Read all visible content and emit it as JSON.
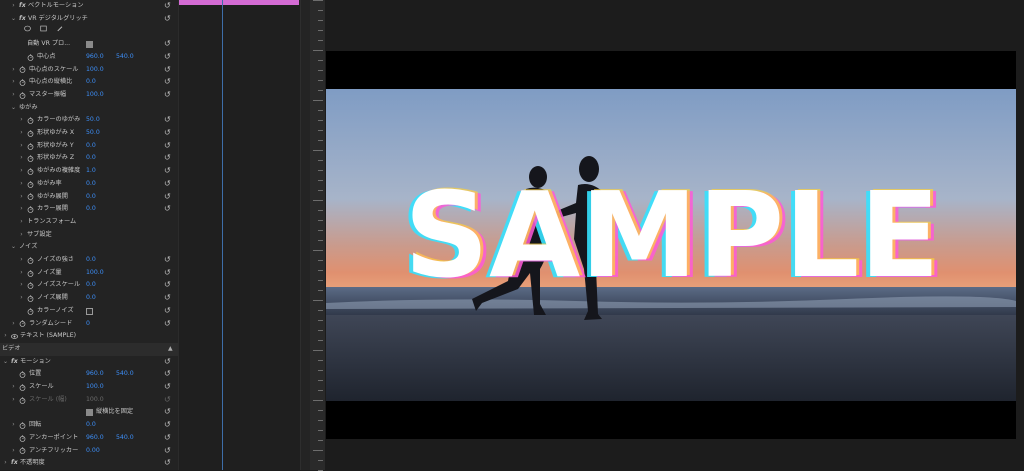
{
  "effect_controls": {
    "rows": [
      {
        "kind": "prop",
        "indent": 1,
        "twirl": "›",
        "fx": true,
        "label": "ベクトルモーション",
        "reset": true
      },
      {
        "kind": "prop",
        "indent": 1,
        "twirl": "⌄",
        "fx": true,
        "label": "VR デジタルグリッチ",
        "reset": true
      },
      {
        "kind": "masktools"
      },
      {
        "kind": "check",
        "indent": 2,
        "label": "自動 VR プロ...",
        "checked": true,
        "reset": true
      },
      {
        "kind": "prop",
        "indent": 2,
        "stopwatch": true,
        "label": "中心点",
        "value1": "960.0",
        "value2": "540.0",
        "reset": true
      },
      {
        "kind": "prop",
        "indent": 1,
        "twirl": "›",
        "stopwatch": true,
        "label": "中心点のスケール",
        "value1": "100.0",
        "reset": true
      },
      {
        "kind": "prop",
        "indent": 1,
        "twirl": "›",
        "stopwatch": true,
        "label": "中心点の縦横比",
        "value1": "0.0",
        "reset": true
      },
      {
        "kind": "prop",
        "indent": 1,
        "twirl": "›",
        "stopwatch": true,
        "label": "マスター振幅",
        "value1": "100.0",
        "reset": true
      },
      {
        "kind": "group",
        "indent": 1,
        "twirl": "⌄",
        "label": "ゆがみ"
      },
      {
        "kind": "prop",
        "indent": 2,
        "twirl": "›",
        "stopwatch": true,
        "label": "カラーのゆがみ",
        "value1": "50.0",
        "reset": true
      },
      {
        "kind": "prop",
        "indent": 2,
        "twirl": "›",
        "stopwatch": true,
        "label": "形状ゆがみ X",
        "value1": "50.0",
        "reset": true
      },
      {
        "kind": "prop",
        "indent": 2,
        "twirl": "›",
        "stopwatch": true,
        "label": "形状ゆがみ Y",
        "value1": "0.0",
        "reset": true
      },
      {
        "kind": "prop",
        "indent": 2,
        "twirl": "›",
        "stopwatch": true,
        "label": "形状ゆがみ Z",
        "value1": "0.0",
        "reset": true
      },
      {
        "kind": "prop",
        "indent": 2,
        "twirl": "›",
        "stopwatch": true,
        "label": "ゆがみの複雑度",
        "value1": "1.0",
        "reset": true
      },
      {
        "kind": "prop",
        "indent": 2,
        "twirl": "›",
        "stopwatch": true,
        "label": "ゆがみ率",
        "value1": "0.0",
        "reset": true
      },
      {
        "kind": "prop",
        "indent": 2,
        "twirl": "›",
        "stopwatch": true,
        "label": "ゆがみ展開",
        "value1": "0.0",
        "reset": true
      },
      {
        "kind": "prop",
        "indent": 2,
        "twirl": "›",
        "stopwatch": true,
        "label": "カラー展開",
        "value1": "0.0",
        "reset": true
      },
      {
        "kind": "group",
        "indent": 2,
        "twirl": "›",
        "label": "トランスフォーム"
      },
      {
        "kind": "group",
        "indent": 2,
        "twirl": "›",
        "label": "サブ設定"
      },
      {
        "kind": "group",
        "indent": 1,
        "twirl": "⌄",
        "label": "ノイズ"
      },
      {
        "kind": "prop",
        "indent": 2,
        "twirl": "›",
        "stopwatch": true,
        "label": "ノイズの強さ",
        "value1": "0.0",
        "reset": true
      },
      {
        "kind": "prop",
        "indent": 2,
        "twirl": "›",
        "stopwatch": true,
        "label": "ノイズ量",
        "value1": "100.0",
        "reset": true
      },
      {
        "kind": "prop",
        "indent": 2,
        "twirl": "›",
        "stopwatch": true,
        "label": "ノイズスケール",
        "value1": "0.0",
        "reset": true
      },
      {
        "kind": "prop",
        "indent": 2,
        "twirl": "›",
        "stopwatch": true,
        "label": "ノイズ展開",
        "value1": "0.0",
        "reset": true
      },
      {
        "kind": "check",
        "indent": 2,
        "stopwatch": true,
        "label": "カラーノイズ",
        "checked": false,
        "reset": true
      },
      {
        "kind": "prop",
        "indent": 1,
        "twirl": "›",
        "stopwatch": true,
        "label": "ランダムシード",
        "value1": "0",
        "reset": true
      },
      {
        "kind": "text",
        "indent": 0,
        "twirl": "›",
        "eye": true,
        "label": "テキスト (SAMPLE)"
      },
      {
        "kind": "section",
        "label": "ビデオ"
      },
      {
        "kind": "prop",
        "indent": 0,
        "twirl": "⌄",
        "fx": true,
        "label": "モーション",
        "reset": true
      },
      {
        "kind": "prop",
        "indent": 1,
        "stopwatch": true,
        "label": "位置",
        "value1": "960.0",
        "value2": "540.0",
        "reset": true
      },
      {
        "kind": "prop",
        "indent": 1,
        "twirl": "›",
        "stopwatch": true,
        "label": "スケール",
        "value1": "100.0",
        "reset": true
      },
      {
        "kind": "prop",
        "indent": 1,
        "twirl": "›",
        "stopwatch": true,
        "label": "スケール (幅)",
        "value1": "100.0",
        "reset": true,
        "dim": true
      },
      {
        "kind": "check",
        "indent": 3,
        "label": "縦横比を固定",
        "checked": true,
        "reset": true
      },
      {
        "kind": "prop",
        "indent": 1,
        "twirl": "›",
        "stopwatch": true,
        "label": "回転",
        "value1": "0.0",
        "reset": true
      },
      {
        "kind": "prop",
        "indent": 1,
        "stopwatch": true,
        "label": "アンカーポイント",
        "value1": "960.0",
        "value2": "540.0",
        "reset": true
      },
      {
        "kind": "prop",
        "indent": 1,
        "twirl": "›",
        "stopwatch": true,
        "label": "アンチフリッカー",
        "value1": "0.00",
        "reset": true
      },
      {
        "kind": "prop",
        "indent": 0,
        "twirl": "›",
        "fx": true,
        "label": "不透明度",
        "reset": true
      }
    ]
  },
  "program_monitor": {
    "overlay_text": "SAMPLE",
    "colors": {
      "sky_top": "#7f9cc4",
      "horizon": "#d79079",
      "sea": "#4a5a72",
      "sand": "#3a4150",
      "glitch_cyan": "#36e2ff",
      "glitch_pink": "#ff5ad8",
      "glitch_yellow": "#ffd23a"
    }
  },
  "timeline": {
    "clip_color": "#d36bd3"
  }
}
